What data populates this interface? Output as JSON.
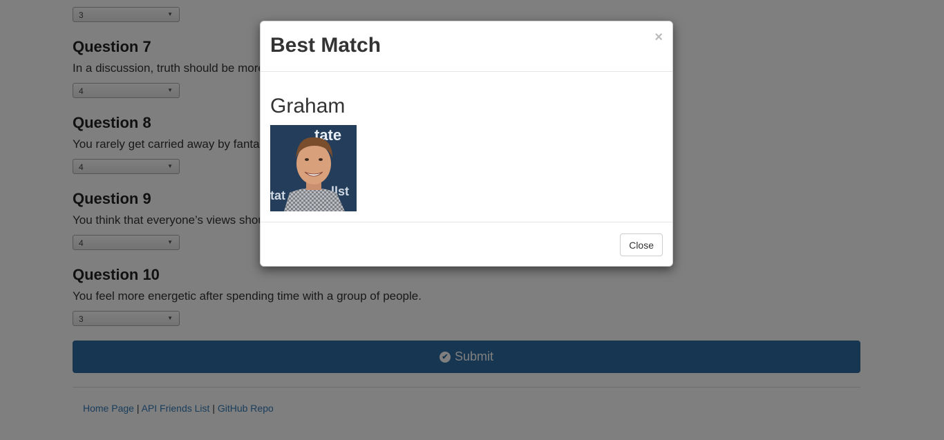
{
  "questions": [
    {
      "value": "3"
    },
    {
      "title": "Question 7",
      "text": "In a discussion, truth should be more important than people's sensitivities.",
      "value": "4"
    },
    {
      "title": "Question 8",
      "text": "You rarely get carried away by fantasies and ideas.",
      "value": "4"
    },
    {
      "title": "Question 9",
      "text": "You think that everyone’s views should be respected regardless of whether they are supported by facts or not.",
      "value": "4"
    },
    {
      "title": "Question 10",
      "text": "You feel more energetic after spending time with a group of people.",
      "value": "3"
    }
  ],
  "submit_label": "Submit",
  "footer": {
    "home": "Home Page",
    "sep1": "|",
    "api": "API Friends List",
    "sep2": "|",
    "github": "GitHub Repo"
  },
  "modal": {
    "title": "Best Match",
    "close_x": "×",
    "match_name": "Graham",
    "close_label": "Close"
  },
  "icons": {
    "submit": "check-circle-icon",
    "close": "close-icon",
    "dropdown": "dropdown-arrow-icon"
  },
  "colors": {
    "primary": "#2d6ca2",
    "link": "#337ab7",
    "backdrop": "rgba(0,0,0,0.5)"
  }
}
